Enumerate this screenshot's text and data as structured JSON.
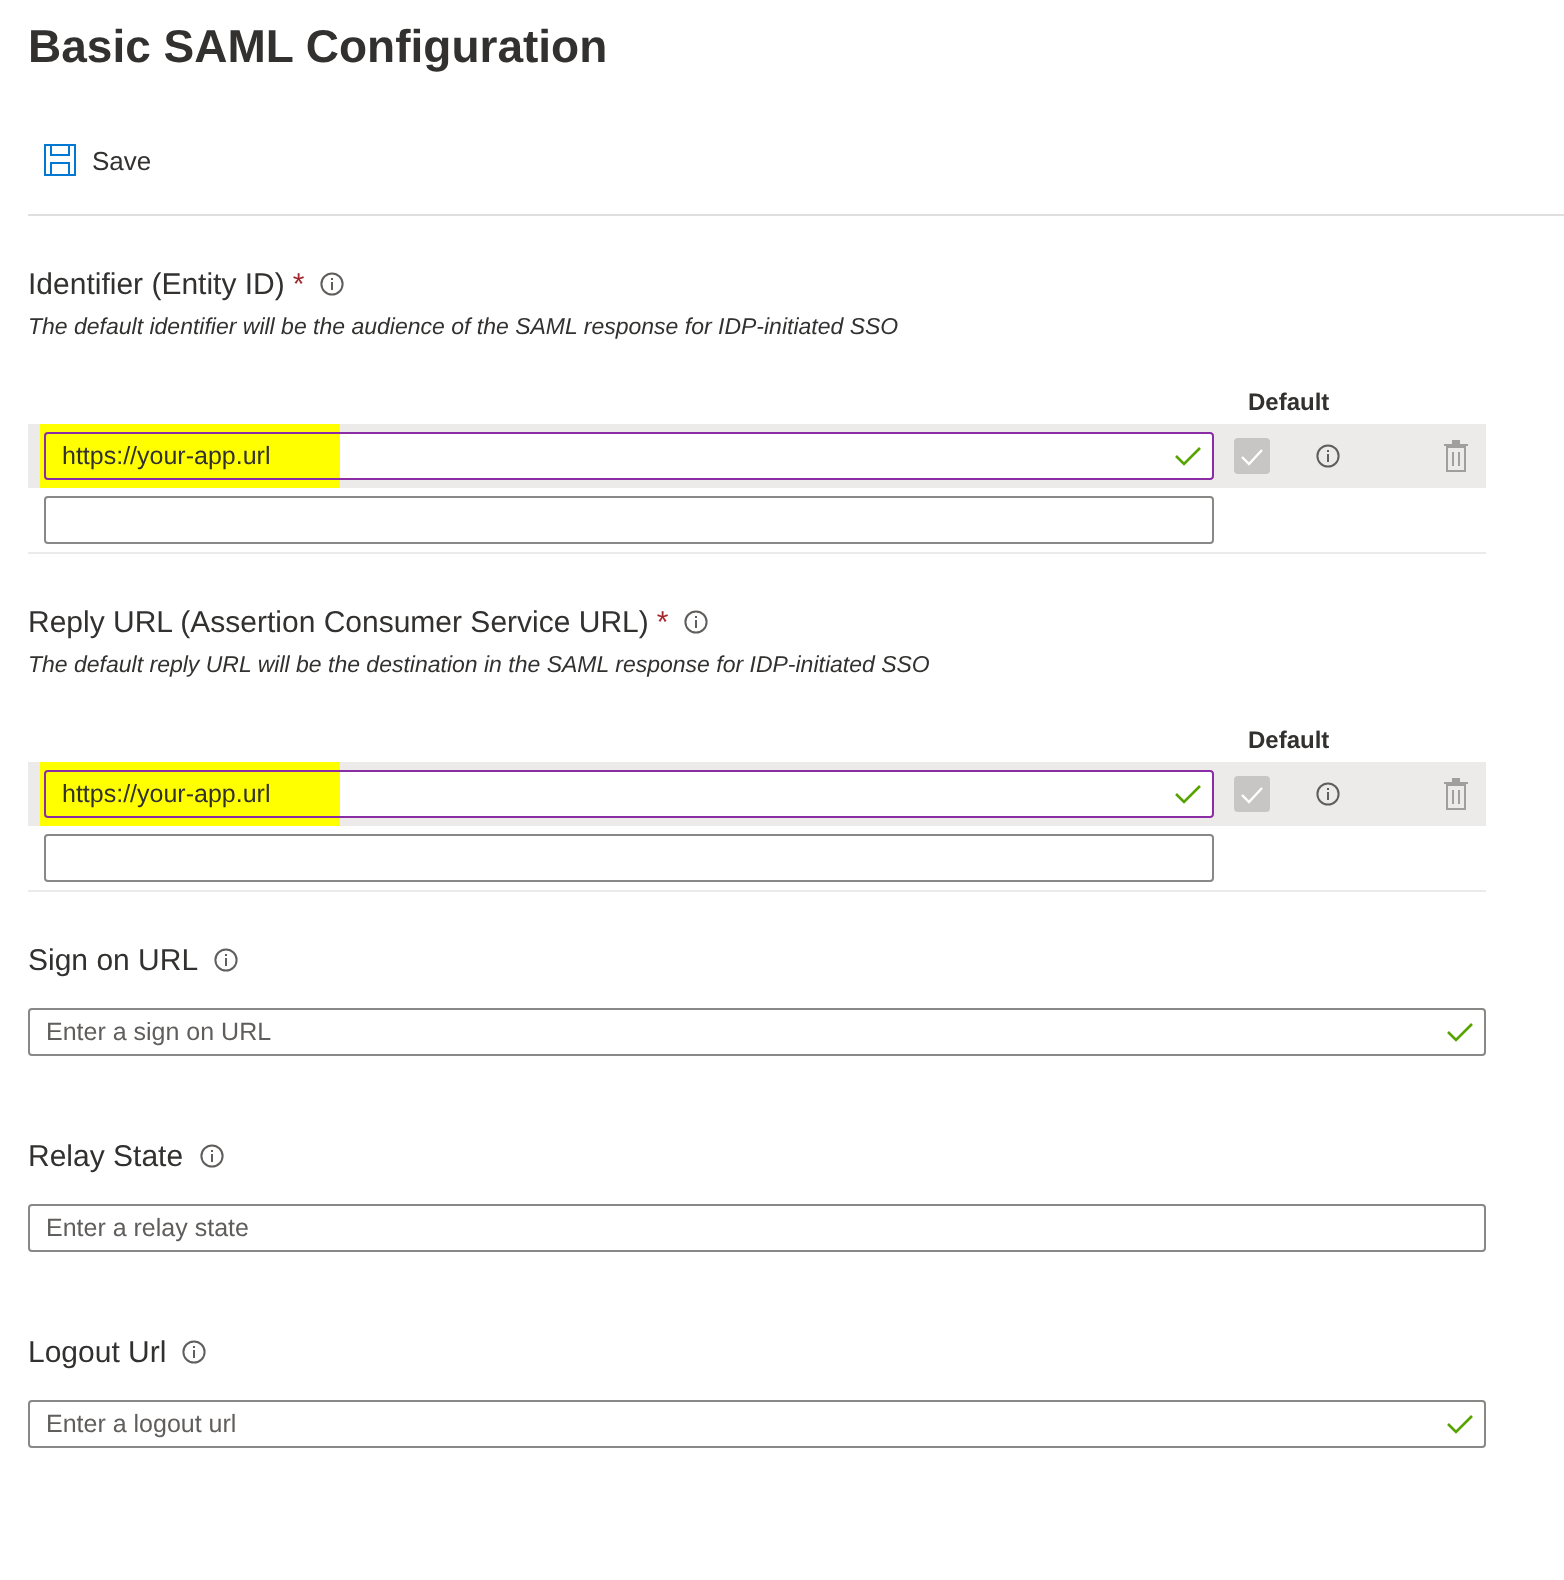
{
  "title": "Basic SAML Configuration",
  "toolbar": {
    "save": "Save"
  },
  "multi_fields": [
    {
      "label": "Identifier (Entity ID)",
      "required_mark": "*",
      "description": "The default identifier will be the audience of the SAML response for IDP-initiated SSO",
      "default_header": "Default",
      "rows": [
        {
          "value": "https://your-app.url",
          "highlighted": true,
          "valid": true,
          "default_checked": true
        },
        {
          "value": "",
          "valid": false
        }
      ]
    },
    {
      "label": "Reply URL (Assertion Consumer Service URL)",
      "required_mark": "*",
      "description": "The default reply URL will be the destination in the SAML response for IDP-initiated SSO",
      "default_header": "Default",
      "rows": [
        {
          "value": "https://your-app.url",
          "highlighted": true,
          "valid": true,
          "default_checked": true
        },
        {
          "value": "",
          "valid": false
        }
      ]
    }
  ],
  "single_fields": [
    {
      "label": "Sign on URL",
      "placeholder": "Enter a sign on URL",
      "valid": true
    },
    {
      "label": "Relay State",
      "placeholder": "Enter a relay state",
      "valid": false
    },
    {
      "label": "Logout Url",
      "placeholder": "Enter a logout url",
      "valid": true
    }
  ]
}
